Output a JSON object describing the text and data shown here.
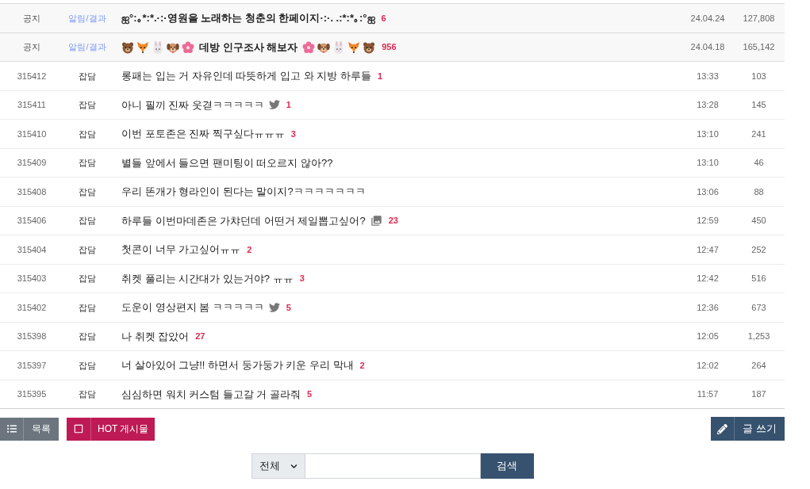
{
  "rows": [
    {
      "kind": "notice",
      "number": "공지",
      "category": "알림/결과",
      "title": "ஐ°:｡*:*.·:·영원을 노래하는 청춘의 한페이지·:·. .:*:*｡:°ஐ",
      "comments": "6",
      "date": "24.04.24",
      "views": "127,808"
    },
    {
      "kind": "notice",
      "number": "공지",
      "category": "알림/결과",
      "title": "데방 인구조사 해보자",
      "emoji_frame": true,
      "comments": "956",
      "date": "24.04.18",
      "views": "165,142"
    },
    {
      "kind": "post",
      "number": "315412",
      "category": "잡담",
      "title": "롱패는 입는 거 자유인데 따뜻하게 입고 와 지방 하루들",
      "comments": "1",
      "date": "13:33",
      "views": "103"
    },
    {
      "kind": "post",
      "number": "315411",
      "category": "잡담",
      "title": "아니 필끼 진짜 웃겯ㅋㅋㅋㅋㅋ",
      "attachment": {
        "kind": "twitter"
      },
      "comments": "1",
      "date": "13:28",
      "views": "145"
    },
    {
      "kind": "post",
      "number": "315410",
      "category": "잡담",
      "title": "이번 포토존은 진짜 찍구싶다ㅠㅠㅠ",
      "comments": "3",
      "date": "13:10",
      "views": "241"
    },
    {
      "kind": "post",
      "number": "315409",
      "category": "잡담",
      "title": "별들 앞에서 들으면 팬미팅이 떠오르지 않아??",
      "date": "13:10",
      "views": "46"
    },
    {
      "kind": "post",
      "number": "315408",
      "category": "잡담",
      "title": "우리 똔개가 형라인이 된다는 말이지?ㅋㅋㅋㅋㅋㅋㅋ",
      "date": "13:06",
      "views": "88"
    },
    {
      "kind": "post",
      "number": "315406",
      "category": "잡담",
      "title": "하루들 이번마데존은 가챠던데 어떤거 제일뽑고싶어?",
      "attachment": {
        "kind": "image"
      },
      "comments": "23",
      "date": "12:59",
      "views": "450"
    },
    {
      "kind": "post",
      "number": "315404",
      "category": "잡담",
      "title": "첫콘이 너무 가고싶어ㅠㅠ",
      "comments": "2",
      "date": "12:47",
      "views": "252"
    },
    {
      "kind": "post",
      "number": "315403",
      "category": "잡담",
      "title": "취켓 풀리는 시간대가 있는거야? ㅠㅠ",
      "comments": "3",
      "date": "12:42",
      "views": "516"
    },
    {
      "kind": "post",
      "number": "315402",
      "category": "잡담",
      "title": "도운이 영상편지 봄 ㅋㅋㅋㅋㅋ",
      "attachment": {
        "kind": "twitter"
      },
      "comments": "5",
      "date": "12:36",
      "views": "673"
    },
    {
      "kind": "post",
      "number": "315398",
      "category": "잡담",
      "title": "나 취켓 잡았어",
      "comments": "27",
      "date": "12:05",
      "views": "1,253"
    },
    {
      "kind": "post",
      "number": "315397",
      "category": "잡담",
      "title": "너 살아있어 그냥!! 하면서 둥가둥가 키운 우리 막내",
      "comments": "2",
      "date": "12:02",
      "views": "264"
    },
    {
      "kind": "post",
      "number": "315395",
      "category": "잡담",
      "title": "심심하면 워치 커스텀 들고갈 거 골라줘",
      "comments": "5",
      "date": "11:57",
      "views": "187"
    }
  ],
  "toolbar": {
    "list_button": {
      "label": "목록"
    },
    "hot_button": {
      "label": "HOT 게시물",
      "checked": false
    },
    "write_button": {
      "label": "글 쓰기"
    }
  },
  "search": {
    "scope": "전체",
    "button": "검색"
  }
}
